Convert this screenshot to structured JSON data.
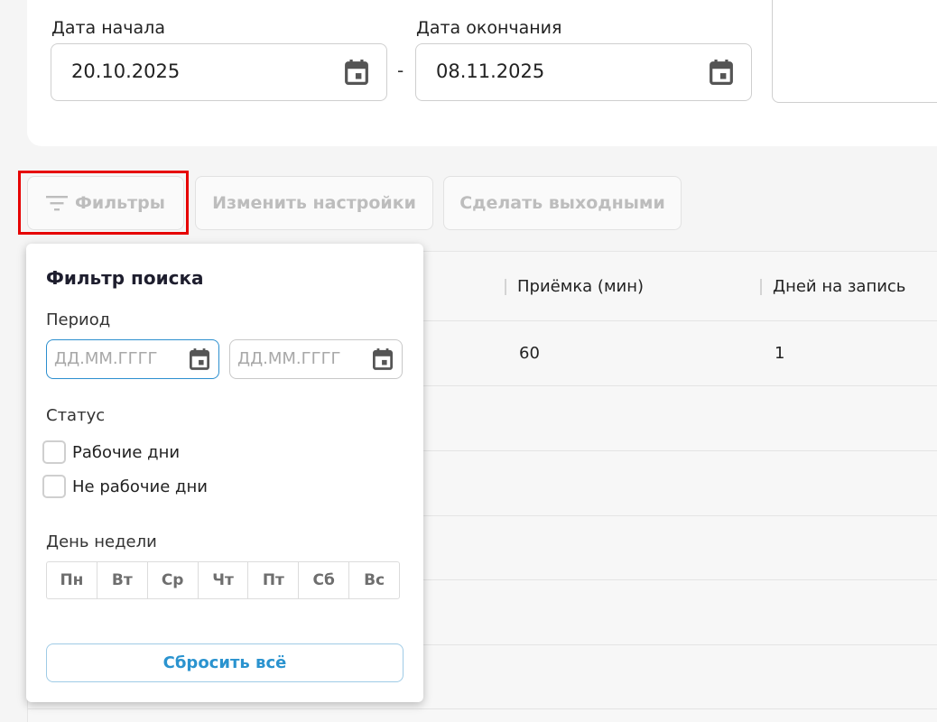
{
  "date_range": {
    "start_label": "Дата начала",
    "start_value": "20.10.2025",
    "end_label": "Дата окончания",
    "end_value": "08.11.2025",
    "separator": "-"
  },
  "toolbar": {
    "filters_label": "Фильтры",
    "change_settings_label": "Изменить настройки",
    "make_days_off_label": "Сделать выходными"
  },
  "table": {
    "headers": [
      "Приёмка (мин)",
      "Дней на запись"
    ],
    "rows": [
      [
        "60",
        "1"
      ]
    ]
  },
  "filter_panel": {
    "title": "Фильтр поиска",
    "period_label": "Период",
    "date_from_placeholder": "ДД.ММ.ГГГГ",
    "date_to_placeholder": "ДД.ММ.ГГГГ",
    "status_label": "Статус",
    "status_options": [
      "Рабочие дни",
      "Не рабочие дни"
    ],
    "weekday_label": "День недели",
    "weekdays": [
      "Пн",
      "Вт",
      "Ср",
      "Чт",
      "Пт",
      "Сб",
      "Вс"
    ],
    "reset_label": "Сбросить всё"
  },
  "colors": {
    "accent_blue": "#2a93cf",
    "highlight_red": "#e60000"
  },
  "icons": [
    "calendar-icon",
    "filter-icon"
  ]
}
